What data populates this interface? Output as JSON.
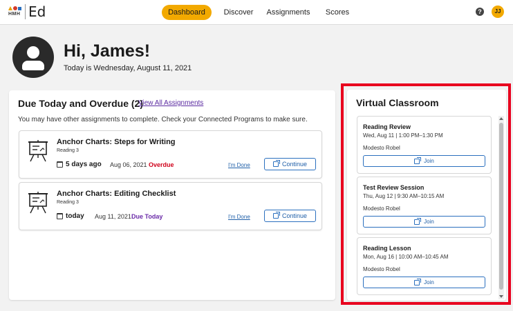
{
  "header": {
    "logo_text": "HMH",
    "brand": "Ed",
    "nav": [
      "Dashboard",
      "Discover",
      "Assignments",
      "Scores"
    ],
    "active_nav": "Dashboard",
    "help_icon": "question-circle-icon",
    "avatar_initials": "JJ"
  },
  "greeting": {
    "title": "Hi, James!",
    "date_line": "Today is Wednesday, August 11, 2021"
  },
  "due": {
    "title": "Due Today and Overdue (2)",
    "view_all": "View All Assignments",
    "note": "You may have other assignments to complete. Check your Connected Programs to make sure.",
    "assignments": [
      {
        "title": "Anchor Charts: Steps for Writing",
        "sub": "Reading 3",
        "relative": "5 days ago",
        "date": "Aug 06, 2021",
        "status": "Overdue",
        "status_color": "#d0021b",
        "done_label": "I'm Done",
        "continue_label": "Continue"
      },
      {
        "title": "Anchor Charts: Editing Checklist",
        "sub": "Reading 3",
        "relative": "today",
        "date": "Aug 11, 2021",
        "status": "Due Today",
        "status_color": "#6a2aa8",
        "done_label": "I'm Done",
        "continue_label": "Continue"
      }
    ]
  },
  "virtual": {
    "title": "Virtual Classroom",
    "sessions": [
      {
        "title": "Reading Review",
        "time": "Wed, Aug 11 | 1:00 PM–1:30 PM",
        "teacher": "Modesto Robel",
        "join": "Join"
      },
      {
        "title": "Test Review Session",
        "time": "Thu, Aug 12 | 9:30 AM–10:15 AM",
        "teacher": "Modesto Robel",
        "join": "Join"
      },
      {
        "title": "Reading Lesson",
        "time": "Mon, Aug 16 | 10:00 AM–10:45 AM",
        "teacher": "Modesto Robel",
        "join": "Join"
      }
    ]
  },
  "colors": {
    "accent": "#f2a900",
    "link": "#1f5fa8",
    "highlight": "#e8001e"
  }
}
